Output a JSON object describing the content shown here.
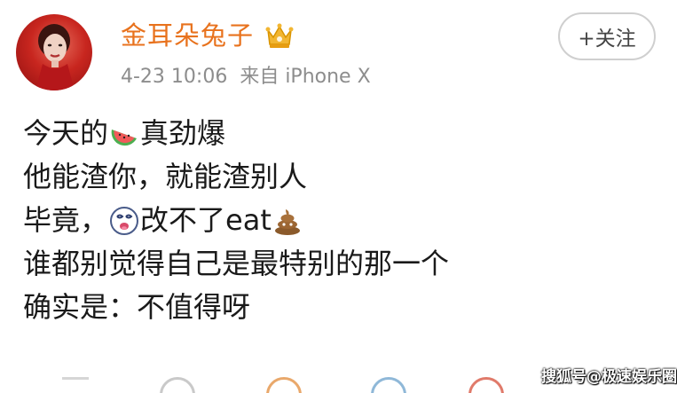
{
  "profile": {
    "username": "金耳朵兔子",
    "badge_icon": "crown-icon",
    "date": "4-23 10:06",
    "source": "来自 iPhone X"
  },
  "follow_button": {
    "label": "+关注"
  },
  "post": {
    "lines": [
      {
        "before": "今天的",
        "emoji": "watermelon-emoji",
        "after": "真劲爆"
      },
      {
        "text": "他能渣你，就能渣别人"
      },
      {
        "before": "毕竟，",
        "emoji": "dizzy-face-emoji",
        "after": "改不了eat",
        "emoji2": "poop-emoji"
      },
      {
        "text": "谁都别觉得自己是最特别的那一个"
      },
      {
        "text": "确实是：不值得呀"
      }
    ]
  },
  "toolbar_icons": [
    "face-icon",
    "basketball-icon",
    "camera-icon",
    "search-icon",
    "more-icon"
  ],
  "watermark": {
    "text": "搜狐号@极速娱乐圈"
  },
  "colors": {
    "username": "#e8721d",
    "meta": "#8d8d8d",
    "body_text": "#1a1a1a",
    "avatar_bg": "#c8261f"
  }
}
